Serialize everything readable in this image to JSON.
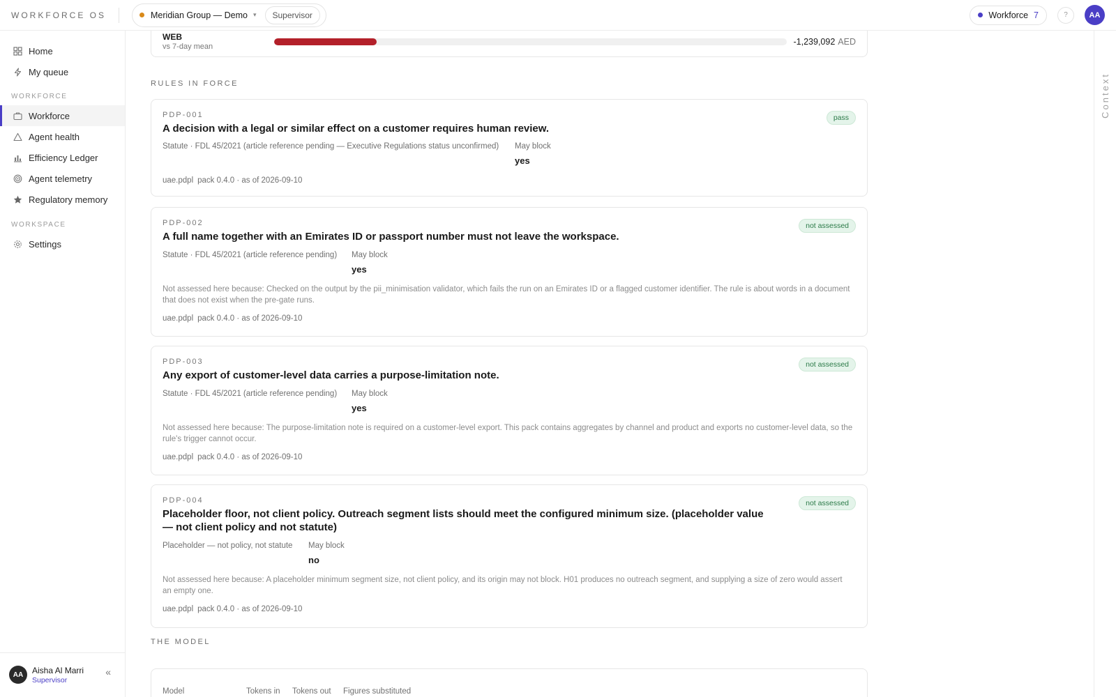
{
  "topbar": {
    "brand": "WORKFORCE OS",
    "org": "Meridian Group — Demo",
    "caret": "▾",
    "role": "Supervisor",
    "workforce_label": "Workforce",
    "workforce_count": "7",
    "help_icon": "?",
    "avatar_initials": "AA"
  },
  "sidebar": {
    "items_top": [
      {
        "label": "Home",
        "icon": "grid-icon"
      },
      {
        "label": "My queue",
        "icon": "lightning-icon"
      }
    ],
    "section_workforce": "WORKFORCE",
    "items_workforce": [
      {
        "label": "Workforce",
        "icon": "briefcase-icon",
        "active": true
      },
      {
        "label": "Agent health",
        "icon": "warning-triangle-icon"
      },
      {
        "label": "Efficiency Ledger",
        "icon": "bar-chart-icon"
      },
      {
        "label": "Agent telemetry",
        "icon": "target-icon"
      },
      {
        "label": "Regulatory memory",
        "icon": "star-icon"
      }
    ],
    "section_workspace": "WORKSPACE",
    "items_workspace": [
      {
        "label": "Settings",
        "icon": "gear-icon"
      }
    ],
    "user": {
      "initials": "AA",
      "name": "Aisha Al Marri",
      "role": "Supervisor",
      "collapse": "«"
    }
  },
  "rail": {
    "label": "Context"
  },
  "web_row": {
    "label": "WEB",
    "sublabel": "vs 7-day mean",
    "bar_fraction": 0.2,
    "bar_color": "#b3202a",
    "value": "-1,239,092",
    "unit": "AED"
  },
  "rules_section": {
    "title": "RULES IN FORCE"
  },
  "rules": [
    {
      "id": "PDP-001",
      "title": "A decision with a legal or similar effect on a customer requires human review.",
      "status": "pass",
      "source": "Statute · FDL 45/2021 (article reference pending — Executive Regulations status unconfirmed)",
      "may_block_label": "May block",
      "may_block": "yes",
      "note": "",
      "pack_id": "uae.pdpl",
      "pack_version": "pack 0.4.0 · as of 2026-09-10"
    },
    {
      "id": "PDP-002",
      "title": "A full name together with an Emirates ID or passport number must not leave the workspace.",
      "status": "not assessed",
      "source": "Statute · FDL 45/2021 (article reference pending)",
      "may_block_label": "May block",
      "may_block": "yes",
      "note": "Not assessed here because: Checked on the output by the pii_minimisation validator, which fails the run on an Emirates ID or a flagged customer identifier. The rule is about words in a document that does not exist when the pre-gate runs.",
      "pack_id": "uae.pdpl",
      "pack_version": "pack 0.4.0 · as of 2026-09-10"
    },
    {
      "id": "PDP-003",
      "title": "Any export of customer-level data carries a purpose-limitation note.",
      "status": "not assessed",
      "source": "Statute · FDL 45/2021 (article reference pending)",
      "may_block_label": "May block",
      "may_block": "yes",
      "note": "Not assessed here because: The purpose-limitation note is required on a customer-level export. This pack contains aggregates by channel and product and exports no customer-level data, so the rule's trigger cannot occur.",
      "pack_id": "uae.pdpl",
      "pack_version": "pack 0.4.0 · as of 2026-09-10"
    },
    {
      "id": "PDP-004",
      "title": "Placeholder floor, not client policy. Outreach segment lists should meet the configured minimum size. (placeholder value — not client policy and not statute)",
      "status": "not assessed",
      "source": "Placeholder — not policy, not statute",
      "may_block_label": "May block",
      "may_block": "no",
      "note": "Not assessed here because: A placeholder minimum segment size, not client policy, and its origin may not block. H01 produces no outreach segment, and supplying a size of zero would assert an empty one.",
      "pack_id": "uae.pdpl",
      "pack_version": "pack 0.4.0 · as of 2026-09-10"
    }
  ],
  "model_section": {
    "title": "THE MODEL",
    "columns": [
      "Model",
      "Tokens in",
      "Tokens out",
      "Figures substituted"
    ]
  }
}
